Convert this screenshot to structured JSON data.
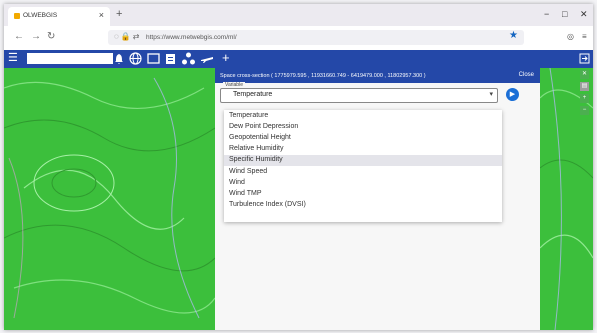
{
  "browser": {
    "tab_title": "OLWEBGIS",
    "tab_close": "×",
    "new_tab": "+",
    "url": "https://www.metwebgis.com/ml/",
    "controls": {
      "minimize": "−",
      "maximize": "□",
      "close": "✕"
    }
  },
  "toolbar": {
    "menu_icon": "☰",
    "search_placeholder": "",
    "icons": [
      "bell-icon",
      "globe-icon",
      "folder-icon",
      "clipboard-icon",
      "nodes-icon",
      "plane-icon",
      "plus-icon"
    ]
  },
  "panel": {
    "title": "Space cross-section ( 1775979.595 , 11931660.749 - 6419479.000 , 11802957.300 )",
    "close_label": "Close",
    "select_label": "Variable",
    "selected_value": "Temperature",
    "options": [
      "Temperature",
      "Dew Point Depression",
      "Geopotential Height",
      "Relative Humidity",
      "Specific Humidity",
      "Wind Speed",
      "Wind",
      "Wind TMP",
      "Turbulence Index (DVSI)"
    ],
    "highlighted_option": "Specific Humidity"
  },
  "colors": {
    "brand": "#2448a8",
    "map_base": "#3cbf3c",
    "go_button": "#1b6fd6"
  }
}
